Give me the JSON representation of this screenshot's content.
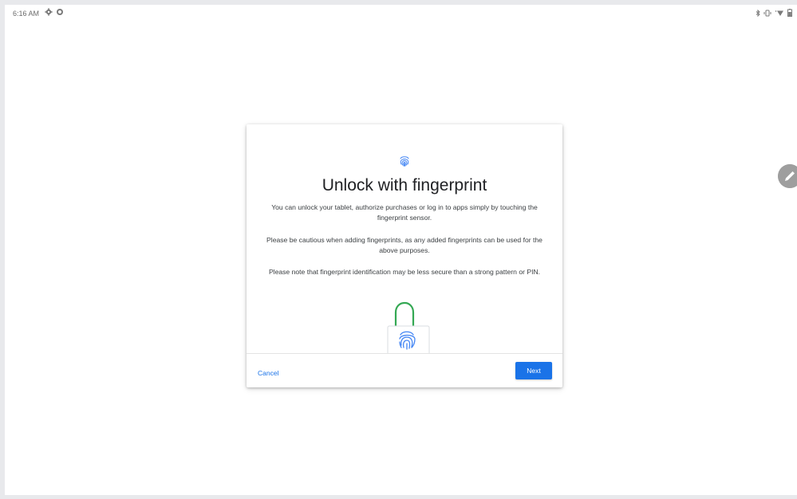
{
  "status_bar": {
    "time": "6:16 AM",
    "left_icons": [
      "settings-icon",
      "circle-icon"
    ],
    "right_icons": [
      "bluetooth-icon",
      "vibrate-icon",
      "wifi-icon",
      "battery-icon"
    ]
  },
  "dialog": {
    "header_icon": "fingerprint-icon",
    "title": "Unlock with fingerprint",
    "paragraphs": [
      "You can unlock your tablet, authorize purchases or log in to apps simply by touching the fingerprint sensor.",
      "Please be cautious when adding fingerprints, as any added fingerprints can be used for the above purposes.",
      "Please note that fingerprint identification may be less secure than a strong pattern or PIN."
    ],
    "illustration": "fingerprint-lock-illustration",
    "cancel_label": "Cancel",
    "next_label": "Next"
  },
  "floating_button": "edit-icon",
  "colors": {
    "accent": "#1a73e8",
    "lock_shackle": "#34a853",
    "fingerprint": "#4285f4",
    "title_text": "#202124",
    "body_text": "#3c4043"
  }
}
